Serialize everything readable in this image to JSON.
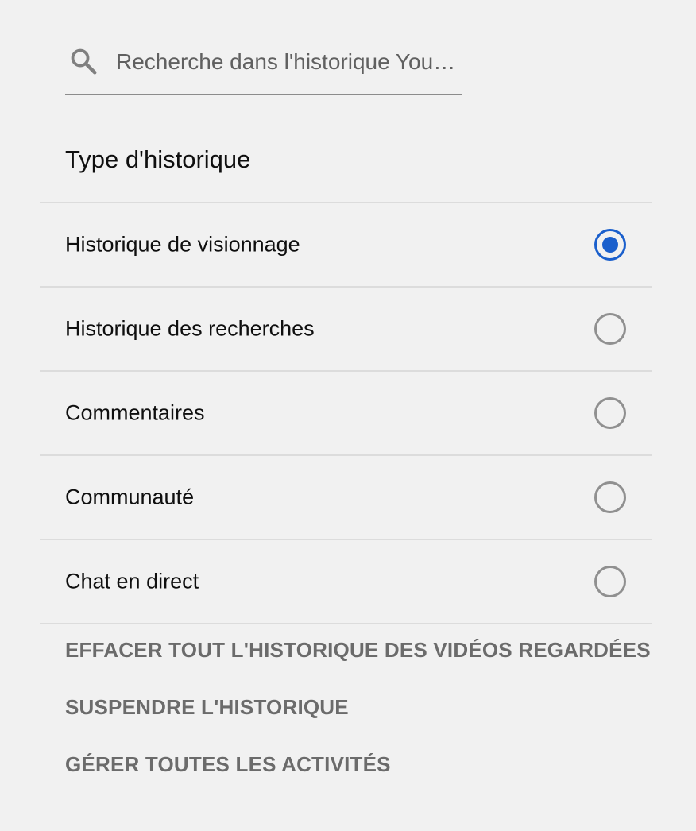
{
  "search": {
    "placeholder": "Recherche dans l'historique YouT…",
    "icon": "search-icon"
  },
  "history_type": {
    "title": "Type d'historique",
    "selected_index": 0,
    "options": [
      {
        "label": "Historique de visionnage",
        "selected": true
      },
      {
        "label": "Historique des recherches",
        "selected": false
      },
      {
        "label": "Commentaires",
        "selected": false
      },
      {
        "label": "Communauté",
        "selected": false
      },
      {
        "label": "Chat en direct",
        "selected": false
      }
    ]
  },
  "actions": {
    "clear_all": "EFFACER TOUT L'HISTORIQUE DES VIDÉOS REGARDÉES",
    "pause": "SUSPENDRE L'HISTORIQUE",
    "manage": "GÉRER TOUTES LES ACTIVITÉS"
  },
  "colors": {
    "background": "#f1f1f1",
    "accent": "#1a5fcc",
    "action_text": "#6b6b6b",
    "divider": "#dcdcdc"
  }
}
